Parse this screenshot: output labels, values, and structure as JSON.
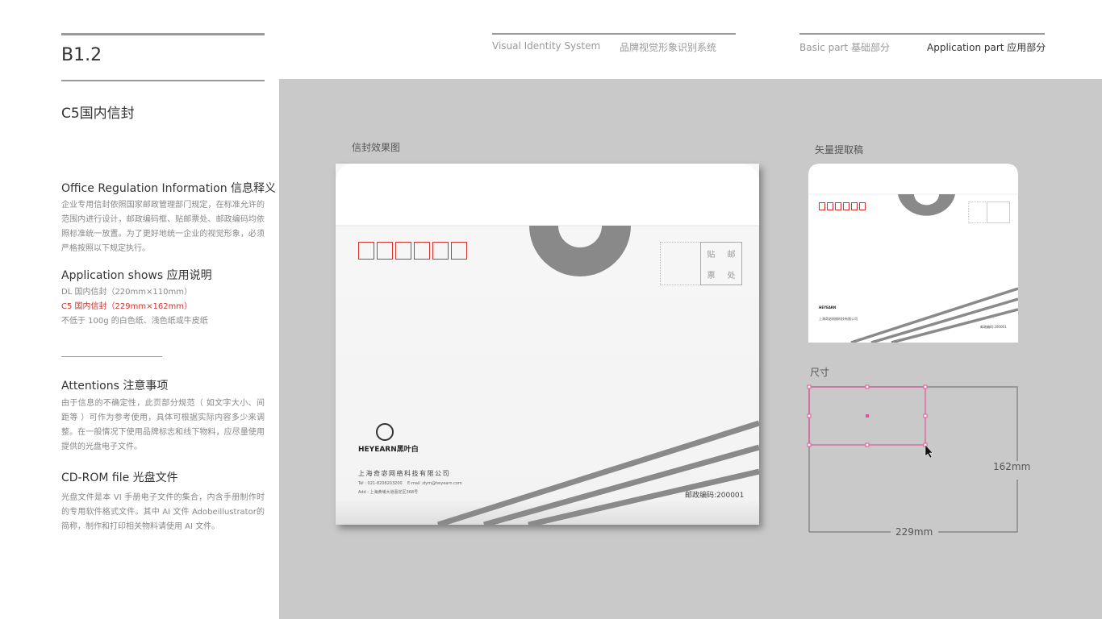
{
  "header": {
    "code": "B1.2",
    "page_title": "C5国内信封",
    "nav_vis_en": "Visual Identity System",
    "nav_vis_cn": "品牌视觉形象识别系统",
    "nav_basic": "Basic part  基础部分",
    "nav_app": "Application part  应用部分"
  },
  "sections": {
    "office": {
      "title": "Office Regulation Information 信息释义",
      "body": "企业专用信封依照国家邮政管理部门规定，在标准允许的范围内进行设计，邮政编码框、贴邮票处、邮政编码均依照标准统一放置。为了更好地统一企业的视觉形象，必须严格按照以下规定执行。"
    },
    "app": {
      "title": "Application shows 应用说明",
      "line1": "DL 国内信封（220mm×110mm）",
      "line2": "C5 国内信封（229mm×162mm）",
      "line3": "不低于 100g 的白色纸、浅色纸或牛皮纸"
    },
    "attn": {
      "title": "Attentions 注意事项",
      "body": "由于信息的不确定性，此页部分规范（ 如文字大小、间距等 ）可作为参考使用，具体可根据实际内容多少来调整。在一般情况下使用品牌标志和线下物料，应尽量使用提供的光盘电子文件。"
    },
    "cd": {
      "title": "CD-ROM file 光盘文件",
      "body": "光盘文件是本 VI 手册电子文件的集合，内含手册制作时的专用软件格式文件。其中 AI 文件 Adobeillustrator的简称，制作和打印相关物料请使用 AI 文件。"
    }
  },
  "stage": {
    "effect_label": "信封效果图",
    "vector_label": "矢量提取稿",
    "size_label": "尺寸",
    "height_dim": "162mm",
    "width_dim": "229mm"
  },
  "envelope": {
    "stamp": [
      "贴",
      "邮",
      "票",
      "处"
    ],
    "brand": "HEYEARN",
    "brand_cn": "黑叶白",
    "company": "上海奇宓网络科技有限公司",
    "tel": "Tel : 021-8208203200    E-mail :dym@heyearn.com",
    "addr": "Add : 上海黄埔大道嘉定区368号",
    "postcode": "邮政编码:200001"
  },
  "colors": {
    "accent_red": "#d4322c",
    "selection_pink": "#e0559a",
    "stage_gray": "#c9c9ca"
  }
}
